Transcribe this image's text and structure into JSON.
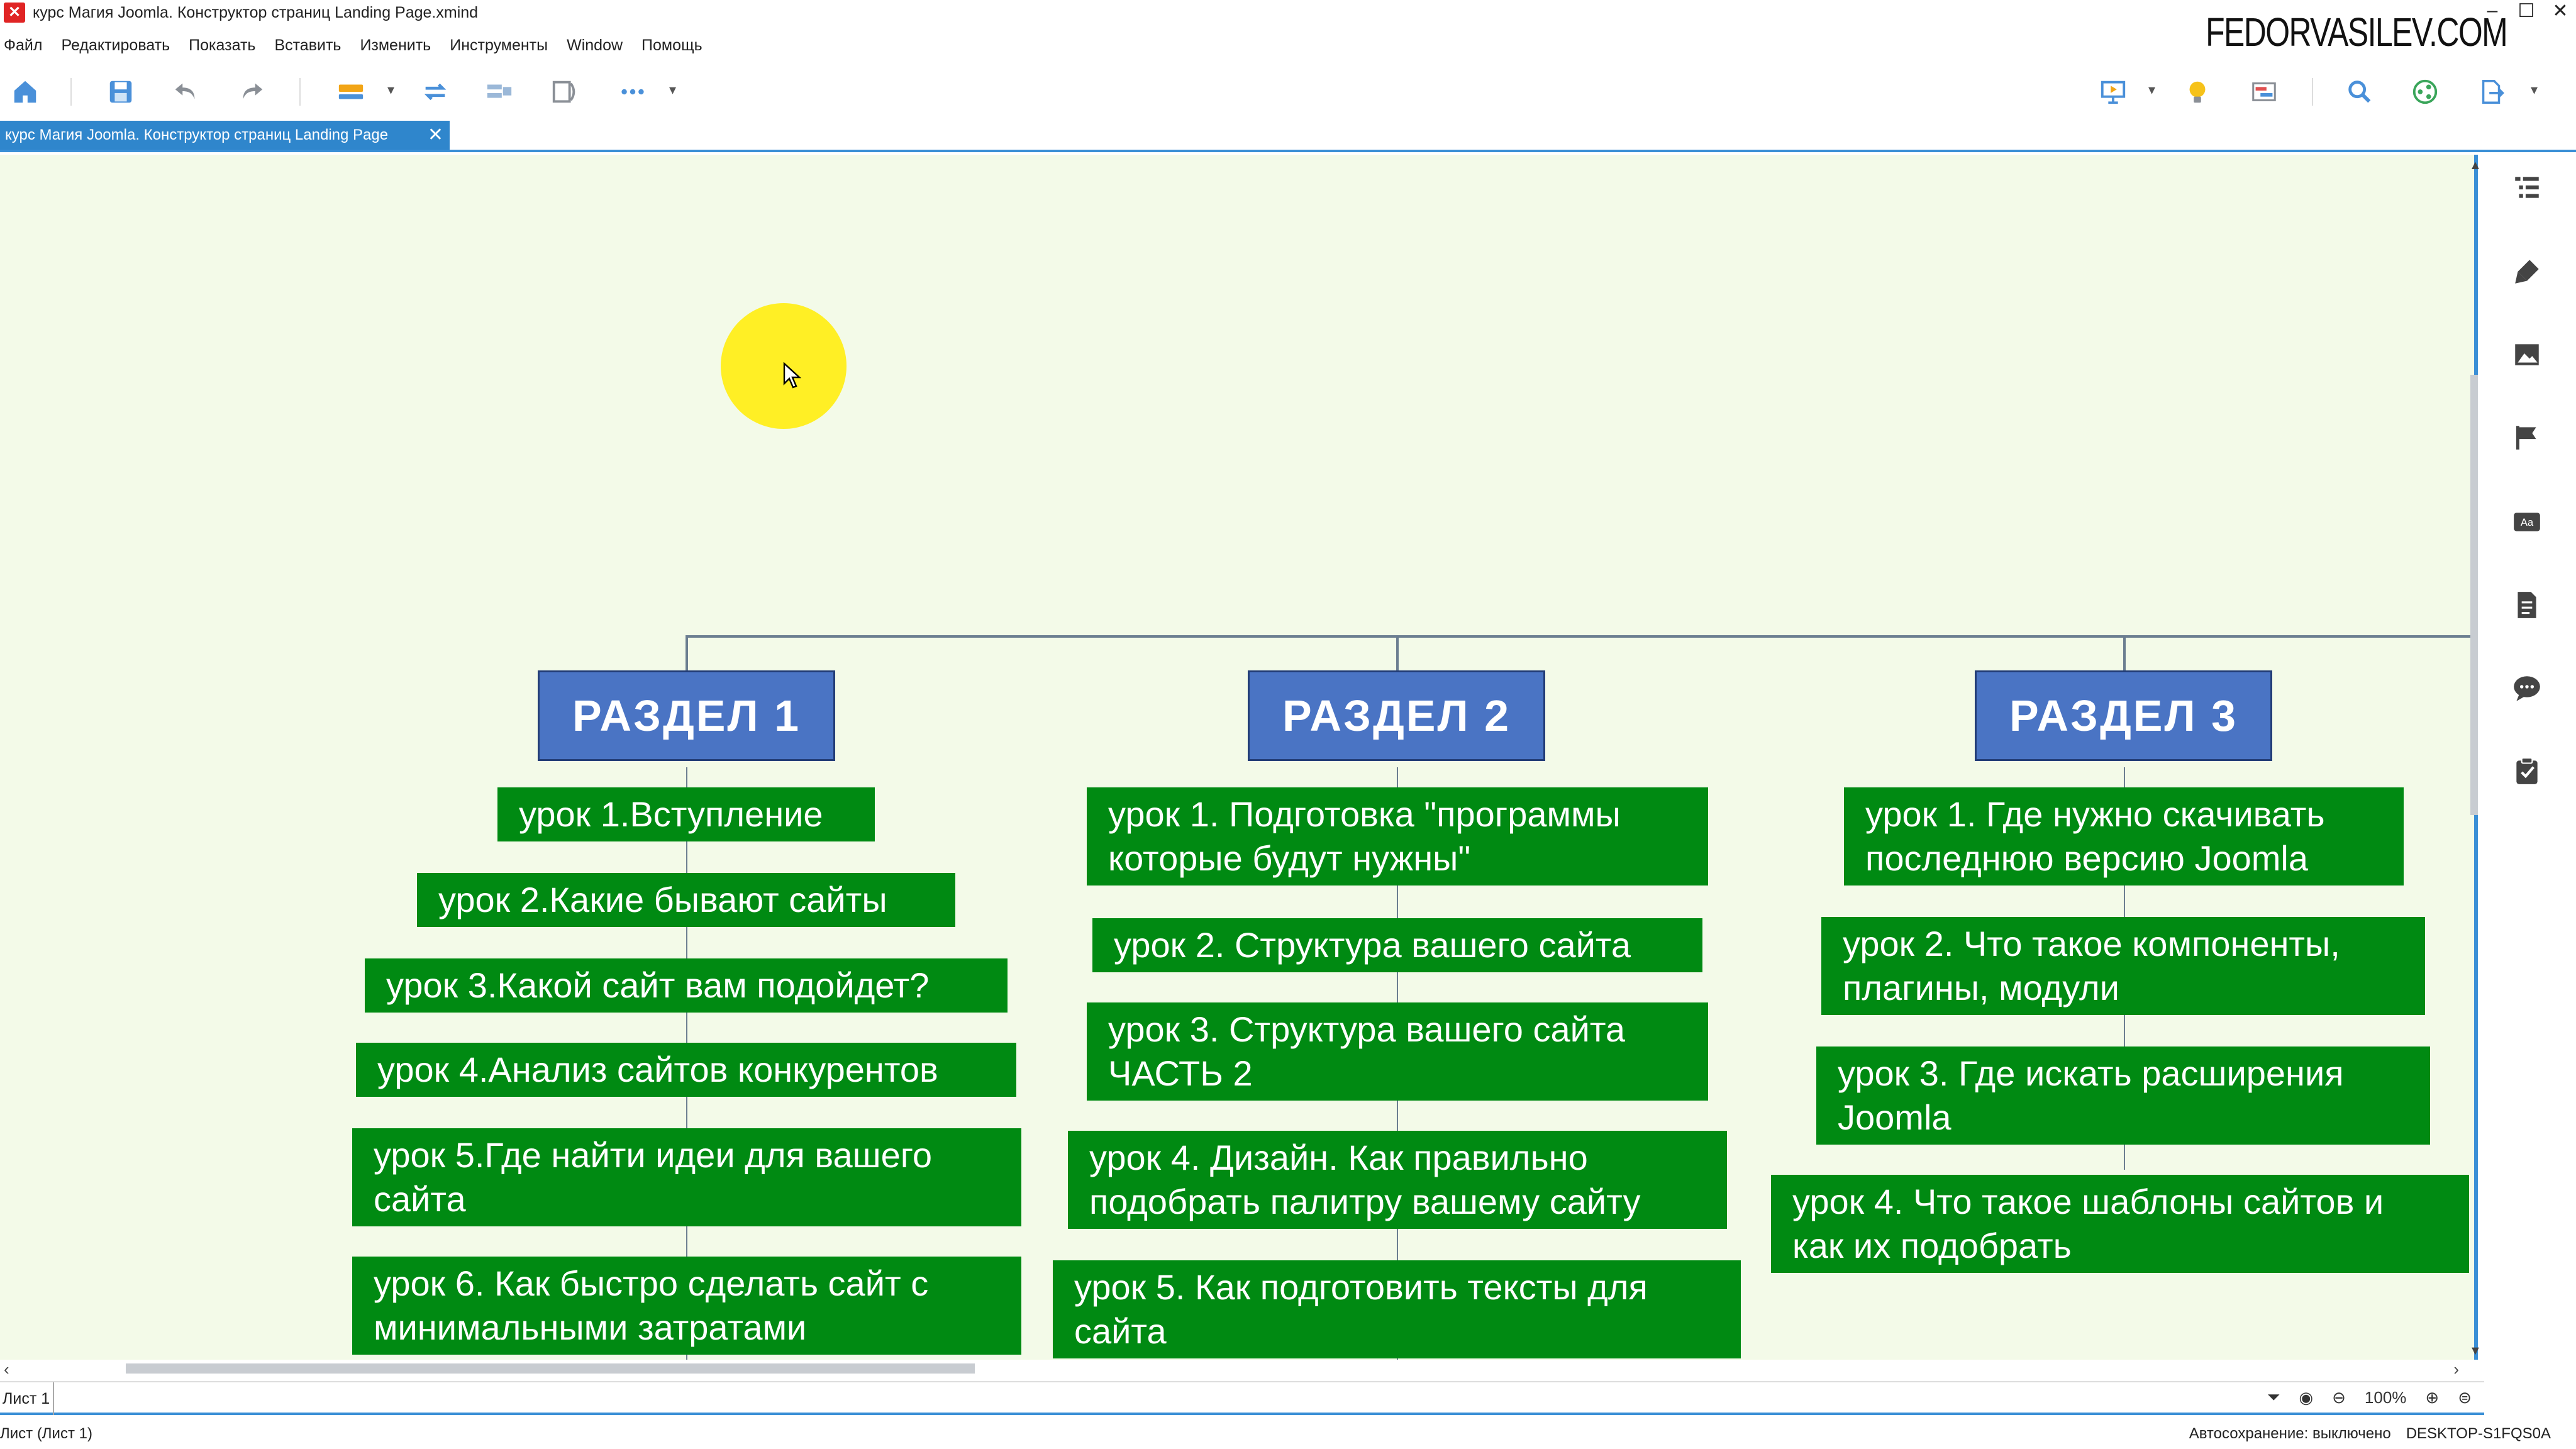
{
  "window": {
    "title": "курс Магия Joomla. Конструктор страниц  Landing Page.xmind",
    "brand": "FEDORVASILEV.COM",
    "controls": [
      "–",
      "☐",
      "✕"
    ]
  },
  "menu": [
    "Файл",
    "Редактировать",
    "Показать",
    "Вставить",
    "Изменить",
    "Инструменты",
    "Window",
    "Помощь"
  ],
  "tab": {
    "label": "курс Магия Joomla. Конструктор страниц  Landing Page",
    "close": "✕"
  },
  "sections": [
    {
      "title": "РАЗДЕЛ 1",
      "lessons": [
        [
          "урок 1.Вступление"
        ],
        [
          "урок 2.Какие бывают сайты"
        ],
        [
          "урок 3.Какой сайт вам подойдет?"
        ],
        [
          "урок 4.Анализ сайтов конкурентов"
        ],
        [
          "урок 5.Где найти идеи для вашего",
          "сайта"
        ],
        [
          "урок 6. Как быстро сделать сайт с",
          "минимальными затратами"
        ]
      ]
    },
    {
      "title": "РАЗДЕЛ 2",
      "lessons": [
        [
          "урок 1. Подготовка \"программы",
          "которые будут нужны\""
        ],
        [
          "урок 2. Структура вашего сайта"
        ],
        [
          "урок 3. Структура вашего сайта",
          "ЧАСТЬ 2"
        ],
        [
          "урок 4. Дизайн. Как правильно",
          "подобрать  палитру вашему сайту"
        ],
        [
          "урок 5. Как подготовить тексты для",
          "сайта"
        ]
      ]
    },
    {
      "title": "РАЗДЕЛ 3",
      "lessons": [
        [
          "урок 1. Где нужно скачивать",
          "последнюю версию Joomla"
        ],
        [
          "урок 2. Что такое компоненты,",
          "плагины, модули"
        ],
        [
          "урок 3. Где искать расширения",
          "Joomla"
        ],
        [
          "урок 4. Что такое шаблоны сайтов и",
          "как их подобрать"
        ]
      ]
    }
  ],
  "sheet": {
    "tab_label": "Лист 1",
    "zoom": "100%"
  },
  "status": {
    "left": "Лист (Лист 1)",
    "autosave": "Автосохранение: выключено",
    "computer": "DESKTOP-S1FQS0A"
  },
  "colors": {
    "canvas_bg": "#f3fae8",
    "section_fill": "#4a74c4",
    "lesson_fill": "#008a12",
    "accent": "#2f86cc"
  }
}
